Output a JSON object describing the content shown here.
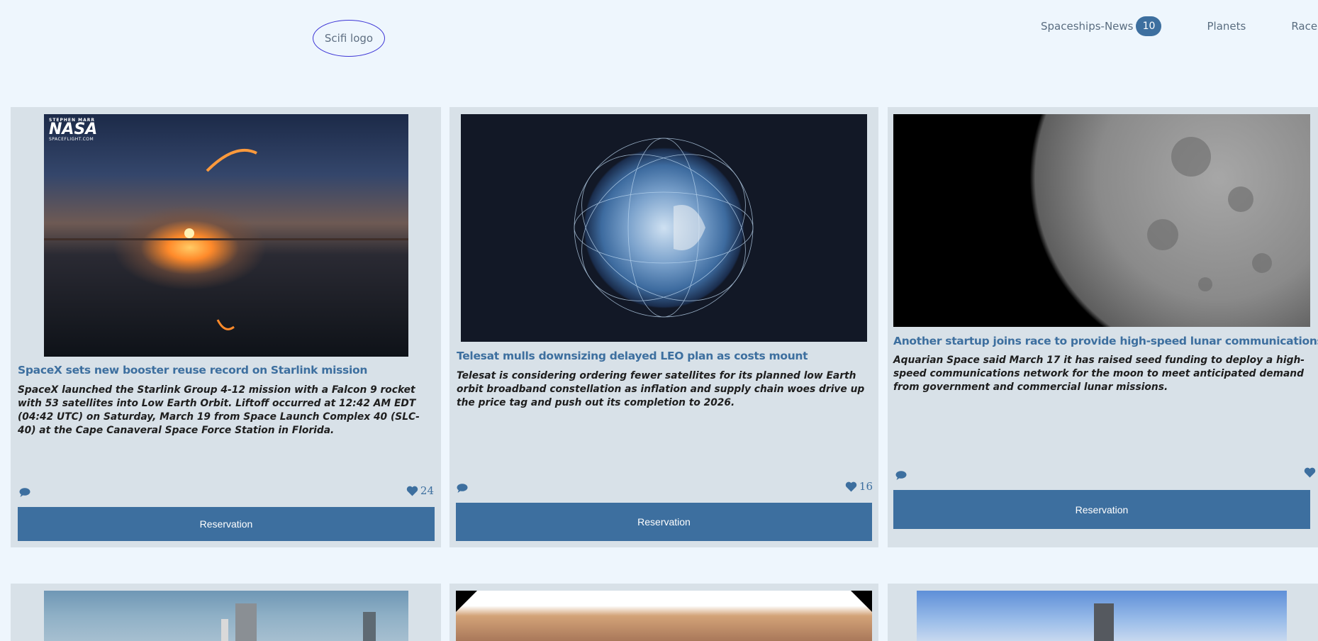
{
  "header": {
    "logo_text": "Scifi logo",
    "nav": [
      {
        "label": "Spaceships-News",
        "badge": "10"
      },
      {
        "label": "Planets"
      },
      {
        "label": "Races"
      }
    ]
  },
  "cards": [
    {
      "title": "SpaceX sets new booster reuse record on Starlink mission",
      "description": "SpaceX launched the Starlink Group 4-12 mission with a Falcon 9 rocket with 53 satellites into Low Earth Orbit. Liftoff occurred at 12:42 AM EDT (04:42 UTC) on Saturday, March 19 from Space Launch Complex 40 (SLC-40) at the Cape Canaveral Space Force Station in Florida.",
      "likes": "24",
      "button": "Reservation",
      "image_watermark": [
        "STEPHEN MARR",
        "NASA",
        "SPACEFLIGHT.COM"
      ]
    },
    {
      "title": "Telesat mulls downsizing delayed LEO plan as costs mount",
      "description": "Telesat is considering ordering fewer satellites for its planned low Earth orbit broadband constellation as inflation and supply chain woes drive up the price tag and push out its completion to 2026.",
      "likes": "16",
      "button": "Reservation"
    },
    {
      "title": "Another startup joins race to provide high-speed lunar communications",
      "description": "Aquarian Space said March 17 it has raised seed funding to deploy a high-speed communications network for the moon to meet anticipated demand from government and commercial lunar missions.",
      "likes": "",
      "button": "Reservation"
    }
  ],
  "icons": {
    "comment": "comment-icon",
    "like": "heart-icon"
  },
  "colors": {
    "accent": "#3d6f9f",
    "card_bg": "#d8e1e8",
    "page_bg": "#eef6fd",
    "logo_border": "#3d35d6"
  }
}
